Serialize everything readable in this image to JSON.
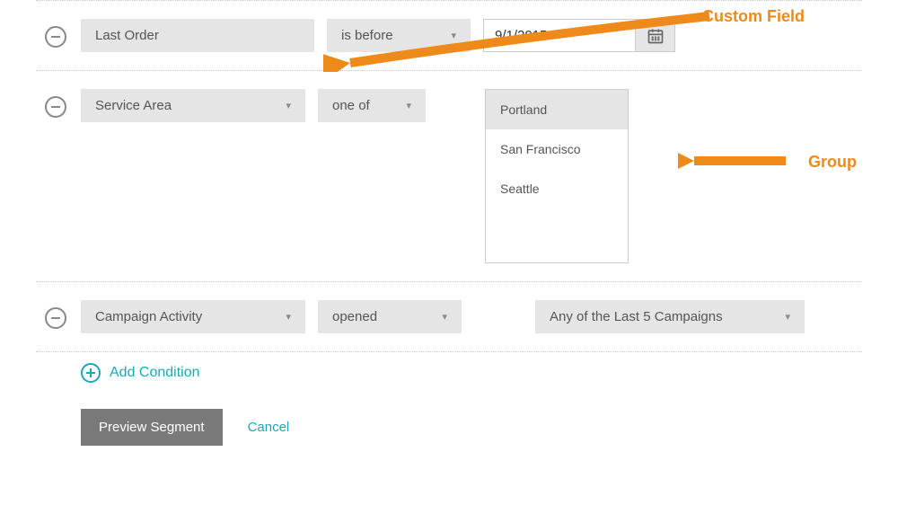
{
  "callouts": {
    "custom_field": "Custom Field",
    "group": "Group"
  },
  "rows": [
    {
      "field": "Last Order",
      "operator": "is before",
      "date_value": "9/1/2015"
    },
    {
      "field": "Service Area",
      "operator": "one of",
      "options": [
        "Portland",
        "San Francisco",
        "Seattle"
      ],
      "selected": "Portland"
    },
    {
      "field": "Campaign Activity",
      "operator": "opened",
      "scope": "Any of the Last 5 Campaigns"
    }
  ],
  "actions": {
    "add_condition": "Add Condition",
    "preview": "Preview Segment",
    "cancel": "Cancel"
  },
  "colors": {
    "accent": "#1ba8bb",
    "callout": "#ed8a1a"
  }
}
